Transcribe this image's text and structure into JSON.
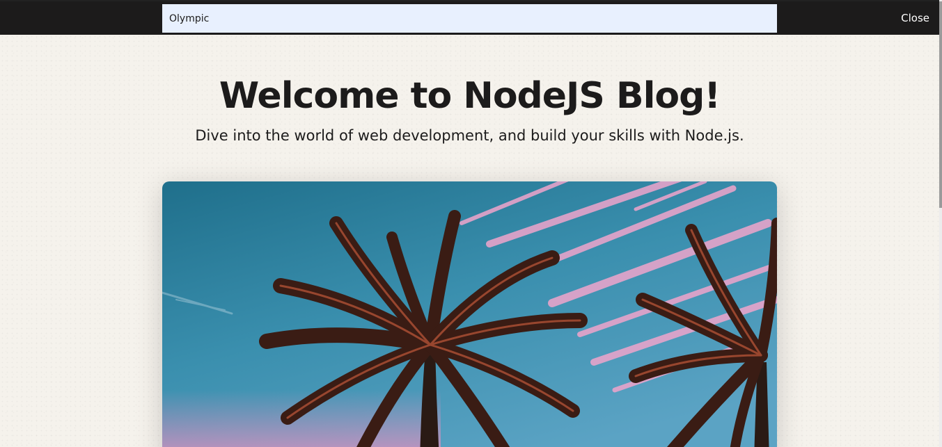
{
  "search": {
    "value": "Olympic",
    "close_label": "Close"
  },
  "hero": {
    "title": "Welcome to NodeJS Blog!",
    "subtitle": "Dive into the world of web development, and build your skills with Node.js."
  },
  "colors": {
    "top_bar": "#1c1b1b",
    "search_field": "#e8f0fe",
    "page_background": "#f5f2ec",
    "text": "#1c1b1b"
  }
}
